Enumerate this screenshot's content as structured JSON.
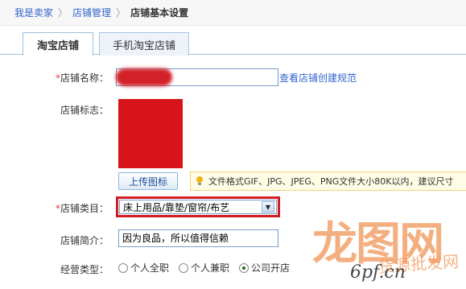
{
  "breadcrumb": {
    "items": [
      "我是卖家",
      "店铺管理"
    ],
    "separator": "〉",
    "current": "店铺基本设置"
  },
  "tabs": [
    "淘宝店铺",
    "手机淘宝店铺"
  ],
  "form": {
    "name_label": "店铺名称：",
    "name_link": "查看店铺创建规范",
    "logo_label": "店铺标志：",
    "upload_label": "上传图标",
    "upload_tip": "文件格式GIF、JPG、JPEG、PNG文件大小80K以内，建议尺寸",
    "category_label": "店铺类目：",
    "category_value": "床上用品/靠垫/窗帘/布艺",
    "intro_label": "店铺简介：",
    "intro_value": "因为良品，所以值得信赖",
    "type_label": "经营类型：",
    "type_options": [
      "个人全职",
      "个人兼职",
      "公司开店"
    ],
    "type_selected": 2,
    "required_mark": "*"
  },
  "watermark": {
    "logo": "龙图网",
    "cn": "货源批发网",
    "url": "6pf.cn"
  },
  "colors": {
    "link": "#3366cc",
    "required": "#e4393c",
    "highlight_border": "#d31b22",
    "redaction": "#d32128"
  }
}
